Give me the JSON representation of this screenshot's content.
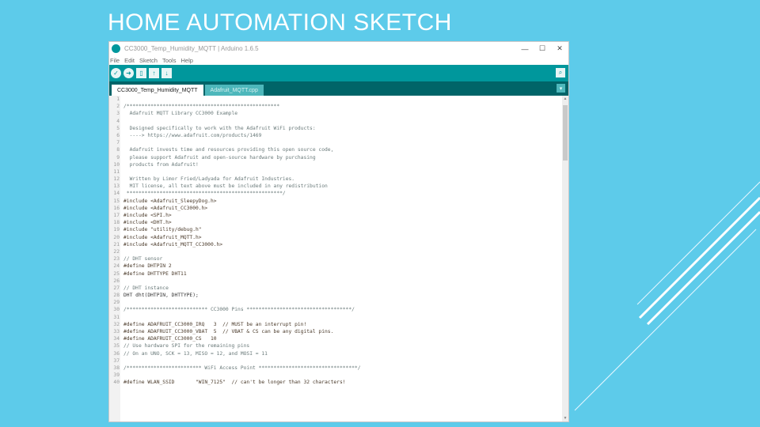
{
  "slide": {
    "title": "HOME AUTOMATION SKETCH"
  },
  "window": {
    "title": "CC3000_Temp_Humidity_MQTT | Arduino 1.6.5",
    "minimize": "—",
    "maximize": "☐",
    "close": "✕"
  },
  "menu": [
    "File",
    "Edit",
    "Sketch",
    "Tools",
    "Help"
  ],
  "toolbar": {
    "verify": "✓",
    "upload": "➜",
    "new": "▯",
    "open": "↑",
    "save": "↓",
    "serial": "⌕"
  },
  "tabs": [
    {
      "label": "CC3000_Temp_Humidity_MQTT",
      "active": true
    },
    {
      "label": "Adafruit_MQTT.cpp",
      "active": false
    }
  ],
  "tab_menu": "▾",
  "colors": {
    "accent": "#00979c",
    "tabbar": "#006468",
    "slide_bg": "#5dcbea"
  },
  "code_lines": [
    {
      "n": "1",
      "t": "",
      "k": "plain"
    },
    {
      "n": "2",
      "t": "/***************************************************",
      "k": "comment"
    },
    {
      "n": "3",
      "t": "  Adafruit MQTT Library CC3000 Example",
      "k": "comment"
    },
    {
      "n": "4",
      "t": "",
      "k": "plain"
    },
    {
      "n": "5",
      "t": "  Designed specifically to work with the Adafruit WiFi products:",
      "k": "comment"
    },
    {
      "n": "6",
      "t": "  ----> https://www.adafruit.com/products/1469",
      "k": "comment"
    },
    {
      "n": "7",
      "t": "",
      "k": "plain"
    },
    {
      "n": "8",
      "t": "  Adafruit invests time and resources providing this open source code,",
      "k": "comment"
    },
    {
      "n": "9",
      "t": "  please support Adafruit and open-source hardware by purchasing",
      "k": "comment"
    },
    {
      "n": "10",
      "t": "  products from Adafruit!",
      "k": "comment"
    },
    {
      "n": "11",
      "t": "",
      "k": "plain"
    },
    {
      "n": "12",
      "t": "  Written by Limor Fried/Ladyada for Adafruit Industries.",
      "k": "comment"
    },
    {
      "n": "13",
      "t": "  MIT license, all text above must be included in any redistribution",
      "k": "comment"
    },
    {
      "n": "14",
      "t": " ****************************************************/",
      "k": "comment"
    },
    {
      "n": "15",
      "t": "#include <Adafruit_SleepyDog.h>",
      "k": "directive"
    },
    {
      "n": "16",
      "t": "#include <Adafruit_CC3000.h>",
      "k": "directive"
    },
    {
      "n": "17",
      "t": "#include <SPI.h>",
      "k": "directive"
    },
    {
      "n": "18",
      "t": "#include <DHT.h>",
      "k": "directive"
    },
    {
      "n": "19",
      "t": "#include \"utility/debug.h\"",
      "k": "directive"
    },
    {
      "n": "20",
      "t": "#include <Adafruit_MQTT.h>",
      "k": "directive"
    },
    {
      "n": "21",
      "t": "#include <Adafruit_MQTT_CC3000.h>",
      "k": "directive"
    },
    {
      "n": "22",
      "t": "",
      "k": "plain"
    },
    {
      "n": "23",
      "t": "// DHT sensor",
      "k": "comment"
    },
    {
      "n": "24",
      "t": "#define DHTPIN 2",
      "k": "directive"
    },
    {
      "n": "25",
      "t": "#define DHTTYPE DHT11",
      "k": "directive"
    },
    {
      "n": "26",
      "t": "",
      "k": "plain"
    },
    {
      "n": "27",
      "t": "// DHT instance",
      "k": "comment"
    },
    {
      "n": "28",
      "t": "DHT dht(DHTPIN, DHTTYPE);",
      "k": "kw"
    },
    {
      "n": "29",
      "t": "",
      "k": "plain"
    },
    {
      "n": "30",
      "t": "/*************************** CC3000 Pins ***********************************/",
      "k": "comment"
    },
    {
      "n": "31",
      "t": "",
      "k": "plain"
    },
    {
      "n": "32",
      "t": "#define ADAFRUIT_CC3000_IRQ   3  // MUST be an interrupt pin!",
      "k": "directive"
    },
    {
      "n": "33",
      "t": "#define ADAFRUIT_CC3000_VBAT  5  // VBAT & CS can be any digital pins.",
      "k": "directive"
    },
    {
      "n": "34",
      "t": "#define ADAFRUIT_CC3000_CS   10",
      "k": "directive"
    },
    {
      "n": "35",
      "t": "// Use hardware SPI for the remaining pins",
      "k": "comment"
    },
    {
      "n": "36",
      "t": "// On an UNO, SCK = 13, MISO = 12, and MOSI = 11",
      "k": "comment"
    },
    {
      "n": "37",
      "t": "",
      "k": "plain"
    },
    {
      "n": "38",
      "t": "/************************* WiFi Access Point *********************************/",
      "k": "comment"
    },
    {
      "n": "39",
      "t": "",
      "k": "plain"
    },
    {
      "n": "40",
      "t": "#define WLAN_SSID       \"WIN_7125\"  // can't be longer than 32 characters!",
      "k": "directive"
    }
  ]
}
